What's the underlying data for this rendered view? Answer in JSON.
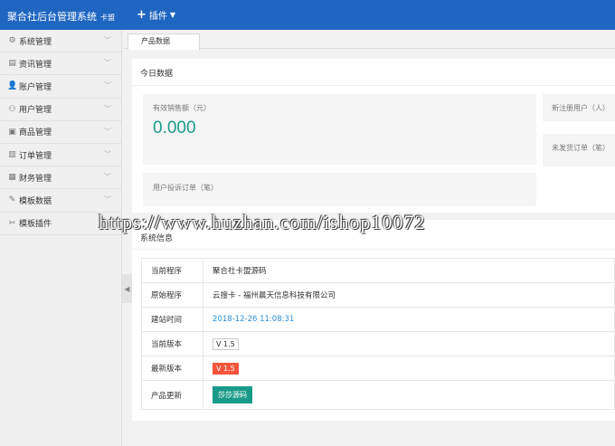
{
  "header": {
    "brand": "聚合社后台管理系统",
    "brand_sub": "卡盟",
    "plugin_menu": "插件"
  },
  "sidebar": {
    "items": [
      {
        "label": "系统管理",
        "icon": "gear-icon",
        "glyph": "⚙"
      },
      {
        "label": "资讯管理",
        "icon": "news-icon",
        "glyph": "▤"
      },
      {
        "label": "账户管理",
        "icon": "user-icon",
        "glyph": "👤"
      },
      {
        "label": "用户管理",
        "icon": "users-icon",
        "glyph": "⚇"
      },
      {
        "label": "商品管理",
        "icon": "cart-icon",
        "glyph": "▣"
      },
      {
        "label": "订单管理",
        "icon": "order-icon",
        "glyph": "▥"
      },
      {
        "label": "财务管理",
        "icon": "finance-icon",
        "glyph": "▦"
      },
      {
        "label": "模板数据",
        "icon": "edit-icon",
        "glyph": "✎"
      },
      {
        "label": "模板插件",
        "icon": "plugin-icon",
        "glyph": "✂"
      }
    ]
  },
  "tabs": [
    {
      "label": "产品数据"
    }
  ],
  "today": {
    "title": "今日数据",
    "sales_label": "有效销售额（元）",
    "sales_value": "0.000",
    "new_users_label": "新注册用户（人）",
    "unshipped_label": "未发货订单（笔）",
    "complaints_label": "用户投诉订单（笔）"
  },
  "watermark": "https://www.huzhan.com/ishop10072",
  "system": {
    "title": "系统信息",
    "rows": [
      {
        "key": "当前程序",
        "value": "聚合社卡盟源码"
      },
      {
        "key": "原始程序",
        "value": "云搜卡 - 福州晨天信息科技有限公司"
      },
      {
        "key": "建站时间",
        "value": "2018-12-26 11:08:31"
      },
      {
        "key": "当前版本",
        "value": "V 1.5"
      },
      {
        "key": "最新版本",
        "value": "V 1.5"
      },
      {
        "key": "产品更新",
        "value": "莎莎源码"
      }
    ]
  },
  "colors": {
    "header_bg": "#1f66c2",
    "accent_teal": "#1a9b8a",
    "badge_red": "#f5553b",
    "link_blue": "#2b8fd6"
  }
}
